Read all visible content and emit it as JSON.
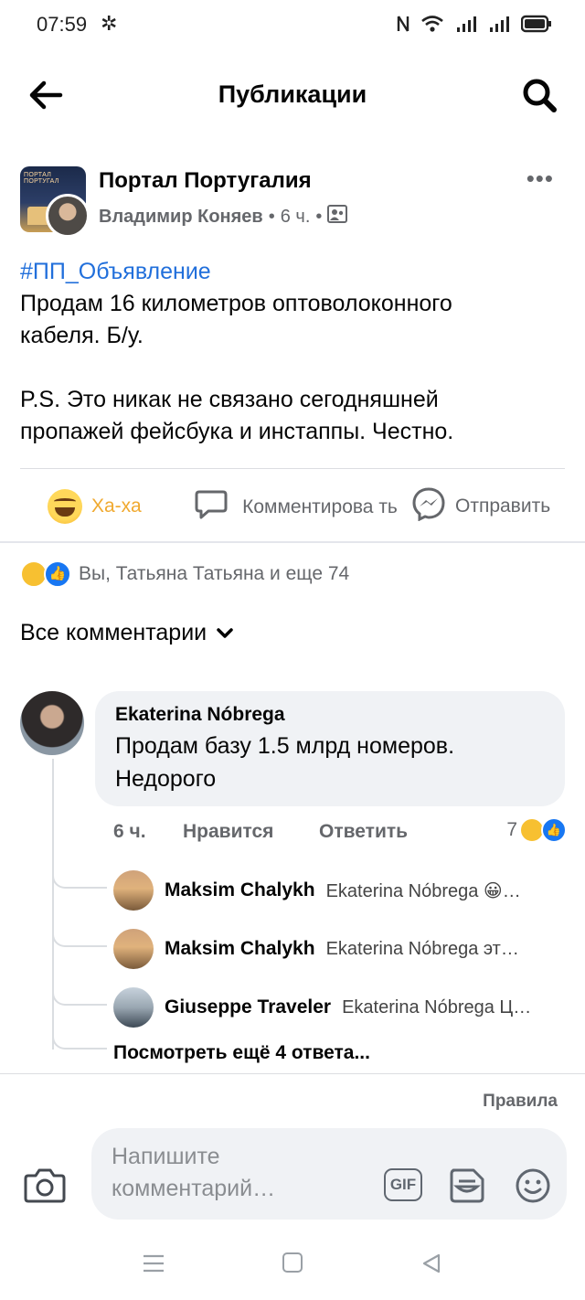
{
  "status_bar": {
    "time": "07:59",
    "settings_glyph": "✲"
  },
  "header": {
    "title": "Публикации"
  },
  "post": {
    "page_name": "Портал Португалия",
    "page_avatar_text": "ПОРТАЛ ПОРТУГАЛ",
    "author": "Владимир Коняев",
    "time": "6 ч.",
    "hashtag": "#ПП_Объявление",
    "body": "Продам 16 километров оптоволоконного\nкабеля. Б/у.\n\nP.S. Это никак не связано сегодняшней\nпропажей фейсбука и инстаппы. Честно."
  },
  "actions": {
    "reaction_label": "Ха-ха",
    "comment_label": "Комментирова ть",
    "share_label": "Отправить"
  },
  "reactions_summary": "Вы, Татьяна Татьяна и еще 74",
  "comments_filter": "Все комментарии",
  "comment": {
    "author": "Ekaterina Nóbrega",
    "text": "Продам базу 1.5 млрд номеров.\nНедорого",
    "time": "6 ч.",
    "like_label": "Нравится",
    "reply_label": "Ответить",
    "reaction_count": "7"
  },
  "replies": [
    {
      "author": "Maksim Chalykh",
      "text": "Ekaterina Nóbrega 😀…"
    },
    {
      "author": "Maksim Chalykh",
      "text": "Ekaterina Nóbrega эт…"
    },
    {
      "author": "Giuseppe Traveler",
      "text": "Ekaterina Nóbrega Ц…"
    }
  ],
  "more_replies": "Посмотреть ещё 4 ответа...",
  "rules_link": "Правила",
  "composer": {
    "placeholder": "Напишите комментарий…",
    "gif_label": "GIF"
  },
  "colors": {
    "accent": "#1877f2",
    "hashtag": "#216fdb",
    "haha": "#f0a92f",
    "muted": "#65676b"
  }
}
